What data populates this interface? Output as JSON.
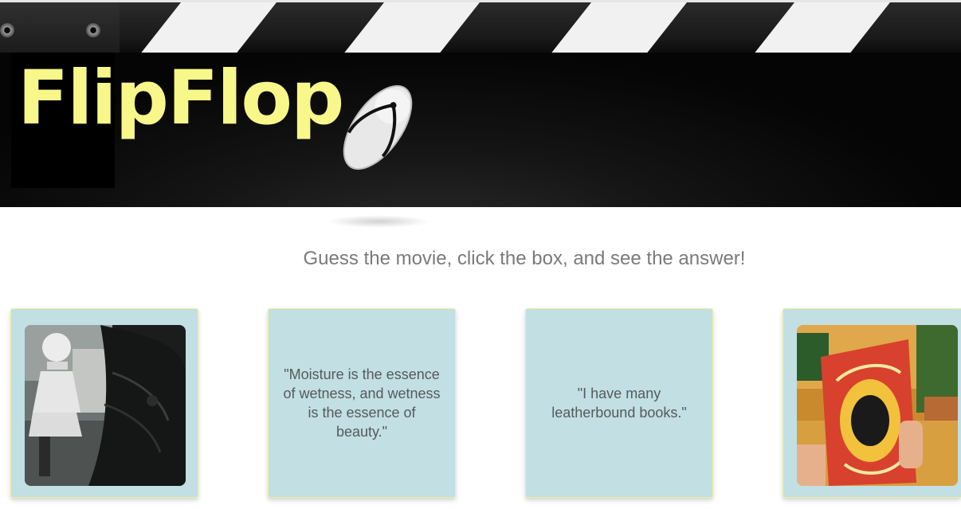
{
  "header": {
    "logo": "FlipFlop",
    "logo_color": "#f8f88a"
  },
  "tagline": "Guess the movie, click the box, and see the answer!",
  "cards": [
    {
      "type": "image",
      "description": "movie still"
    },
    {
      "type": "quote",
      "text": "\"Moisture is the essence of wetness, and wetness is the essence of beauty.\""
    },
    {
      "type": "quote",
      "text": "\"I have many leatherbound books.\""
    },
    {
      "type": "image",
      "description": "movie still"
    }
  ],
  "card_colors": {
    "background": "#c2dfe3",
    "border": "#e9f29a"
  }
}
